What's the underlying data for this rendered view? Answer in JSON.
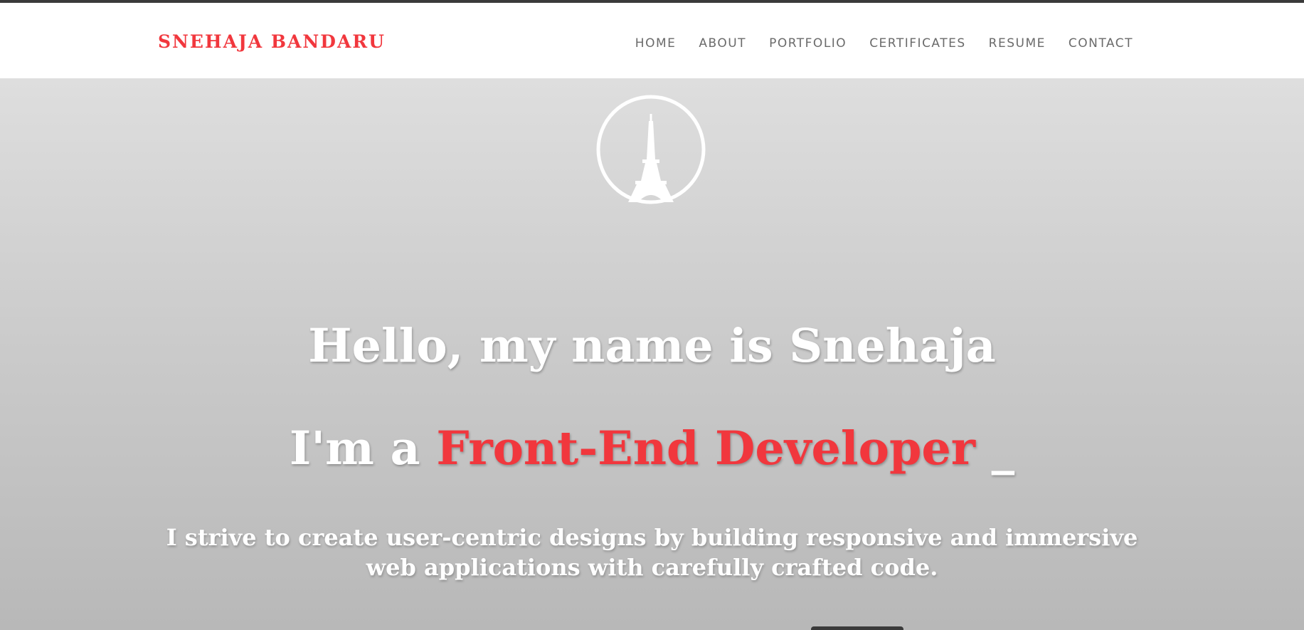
{
  "navbar": {
    "brand": "SNEHAJA BANDARU",
    "links": [
      "HOME",
      "ABOUT",
      "PORTFOLIO",
      "CERTIFICATES",
      "RESUME",
      "CONTACT"
    ]
  },
  "hero": {
    "emblem_icon": "eiffel-tower-icon",
    "title": "Hello, my name is Snehaja",
    "role_prefix": "I'm a ",
    "role_highlight": "Front-End Developer",
    "role_cursor": " _",
    "tagline": "I strive to create user-centric designs by building responsive and immersive web applications with carefully crafted code."
  },
  "colors": {
    "accent": "#f1373d",
    "nav_text": "#6a6a6a",
    "hero_text": "#ffffff",
    "top_strip": "#3a3a3a"
  }
}
